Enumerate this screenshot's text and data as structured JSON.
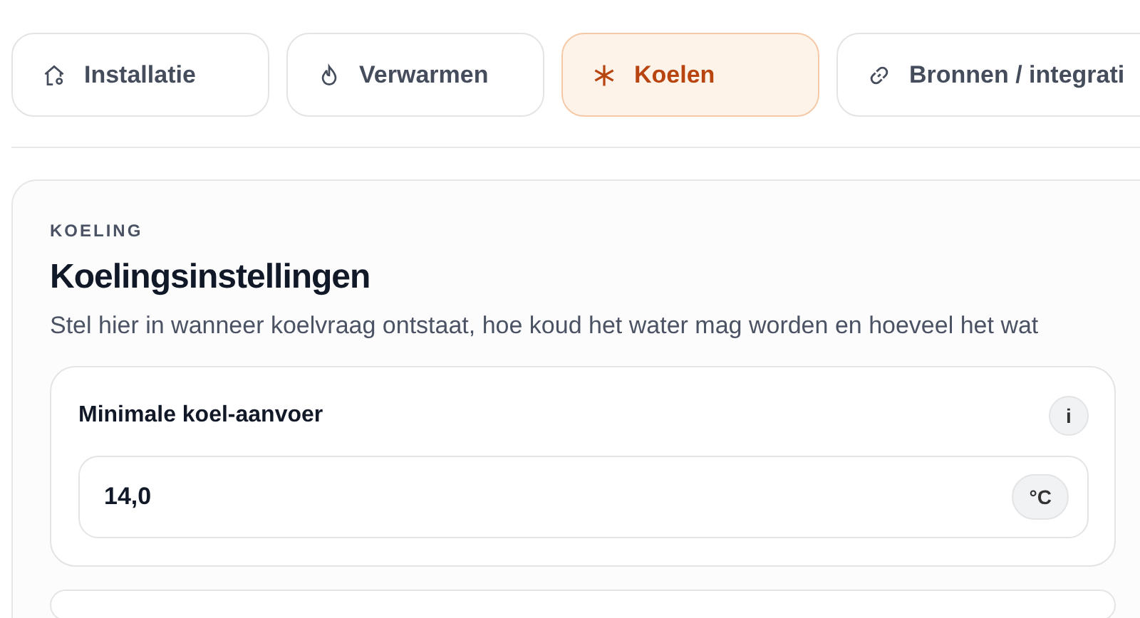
{
  "tabs": [
    {
      "label": "Installatie",
      "kind": "house",
      "selected": false
    },
    {
      "label": "Verwarmen",
      "kind": "flame",
      "selected": false
    },
    {
      "label": "Koelen",
      "kind": "snow",
      "selected": true
    },
    {
      "label": "Bronnen / integrati",
      "kind": "link",
      "selected": false
    }
  ],
  "section": {
    "eyebrow": "KOELING",
    "title": "Koelingsinstellingen",
    "description": "Stel hier in wanneer koelvraag ontstaat, hoe koud het water mag worden en hoeveel het wat",
    "fields": [
      {
        "label": "Minimale koel-aanvoer",
        "info": "i",
        "value": "14,0",
        "unit": "°C"
      }
    ]
  }
}
